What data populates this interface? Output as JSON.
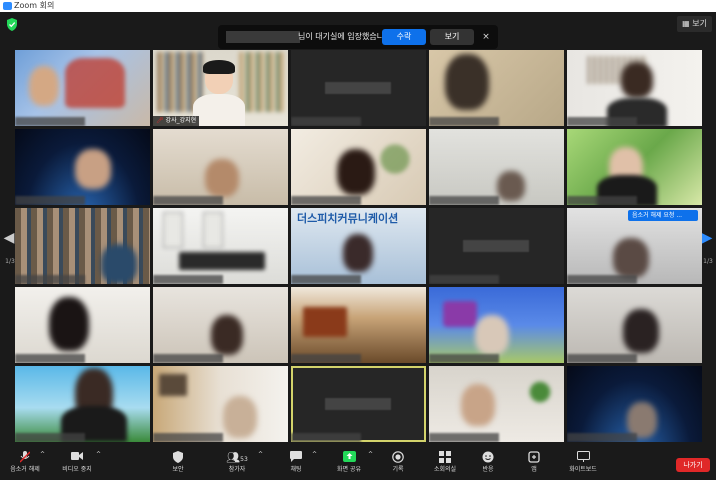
{
  "window": {
    "title": "Zoom 회의"
  },
  "top": {
    "view_label": "보기"
  },
  "waiting_banner": {
    "message": "님이 대기실에 입장했습니다",
    "admit_label": "수락",
    "see_label": "보기",
    "close_glyph": "×"
  },
  "tiles": {
    "host_nameplate": "강사_강지현",
    "watermark": "더스피치커뮤니케이션",
    "unmute_request": "음소거 해제 요청 ..."
  },
  "pagination": {
    "left": "1/3",
    "right": "1/3"
  },
  "toolbar": {
    "unmute": "음소거 해제",
    "stop_video": "비디오 중지",
    "security": "보안",
    "participants": "참가자",
    "participants_count": "53",
    "chat": "채팅",
    "share_screen": "화면 공유",
    "record": "기록",
    "breakout": "소회의실",
    "reactions": "반응",
    "apps": "앱",
    "whiteboard": "화이트보드",
    "leave": "나가기"
  },
  "colors": {
    "accent": "#0e71eb",
    "leave": "#e02828",
    "share": "#23d959",
    "active_speaker": "#d3d36b"
  }
}
